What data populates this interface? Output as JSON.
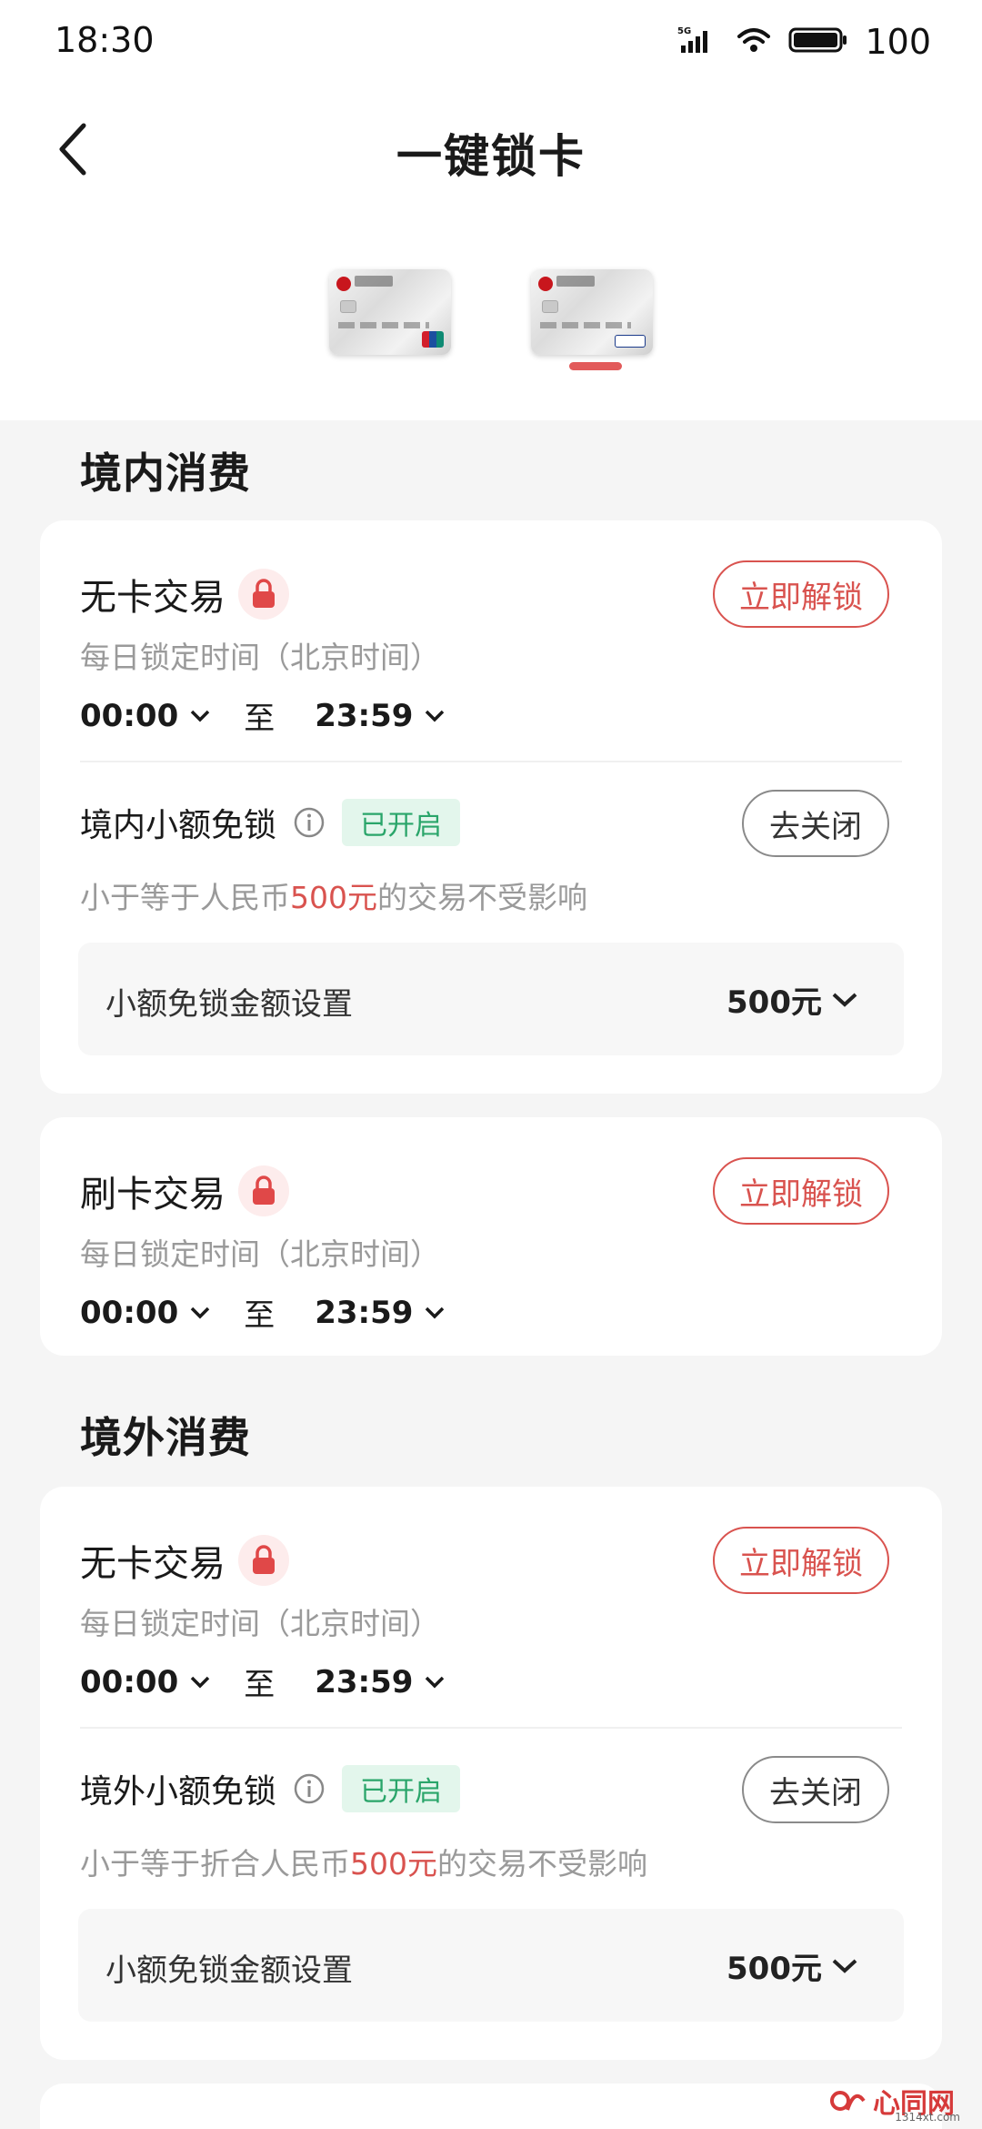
{
  "status_bar": {
    "time": "18:30",
    "network": "5G",
    "battery": "100"
  },
  "nav": {
    "title": "一键锁卡"
  },
  "cards": [
    {
      "name": "card-1",
      "selected": false
    },
    {
      "name": "card-2",
      "selected": true
    }
  ],
  "domestic": {
    "section_title": "境内消费",
    "cardless": {
      "title": "无卡交易",
      "sub": "每日锁定时间（北京时间）",
      "start": "00:00",
      "to": "至",
      "end": "23:59",
      "unlock": "立即解锁"
    },
    "small_free": {
      "title": "境内小额免锁",
      "tag": "已开启",
      "close": "去关闭",
      "desc_prefix": "小于等于人民币",
      "desc_amount": "500元",
      "desc_suffix": "的交易不受影响",
      "setting_label": "小额免锁金额设置",
      "setting_value": "500元"
    },
    "swipe": {
      "title": "刷卡交易",
      "sub": "每日锁定时间（北京时间）",
      "start": "00:00",
      "to": "至",
      "end": "23:59",
      "unlock": "立即解锁"
    }
  },
  "overseas": {
    "section_title": "境外消费",
    "cardless": {
      "title": "无卡交易",
      "sub": "每日锁定时间（北京时间）",
      "start": "00:00",
      "to": "至",
      "end": "23:59",
      "unlock": "立即解锁"
    },
    "small_free": {
      "title": "境外小额免锁",
      "tag": "已开启",
      "close": "去关闭",
      "desc_prefix": "小于等于折合人民币",
      "desc_amount": "500元",
      "desc_suffix": "的交易不受影响",
      "setting_label": "小额免锁金额设置",
      "setting_value": "500元"
    }
  },
  "watermark": {
    "text": "心同网",
    "small": "1314xt.com"
  },
  "colors": {
    "accent_red": "#d9534f",
    "tag_green": "#2aa56a",
    "background": "#f5f5f5"
  },
  "icons": [
    "back-arrow-icon",
    "lock-icon",
    "info-icon",
    "chevron-down-icon",
    "signal-icon",
    "wifi-icon",
    "battery-icon"
  ]
}
